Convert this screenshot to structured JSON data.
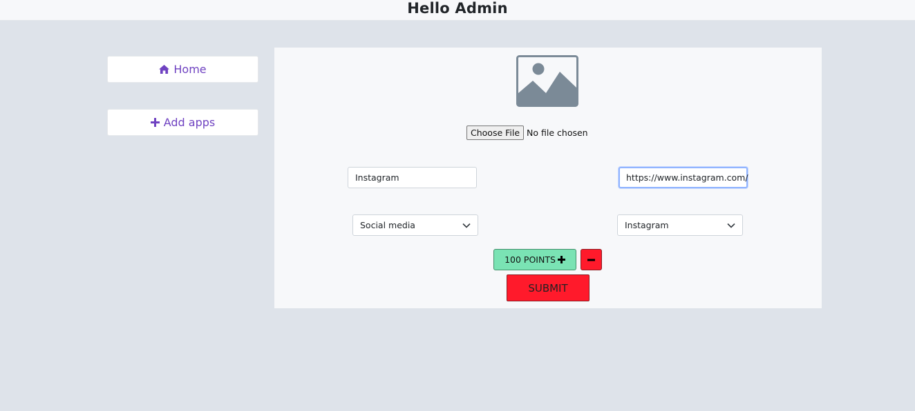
{
  "header": {
    "title": "Hello Admin"
  },
  "sidebar": {
    "items": [
      {
        "label": "Home",
        "icon": "home-icon"
      },
      {
        "label": "Add apps",
        "icon": "plus-icon"
      }
    ]
  },
  "form": {
    "image_placeholder_icon": "image-placeholder-icon",
    "file_input": {
      "button_label": "Choose File",
      "status": "No file chosen"
    },
    "app_name_value": "Instagram",
    "app_url_value": "https://www.instagram.com/",
    "category_selected": "Social media",
    "platform_selected": "Instagram",
    "points_label": "100 POINTS",
    "submit_label": "SUBMIT"
  },
  "colors": {
    "accent": "#6f42c1",
    "points_button": "#7ae3b4",
    "danger": "#ff1a2b",
    "panel_bg": "#f7f8fa",
    "page_bg": "#dee3ea"
  }
}
